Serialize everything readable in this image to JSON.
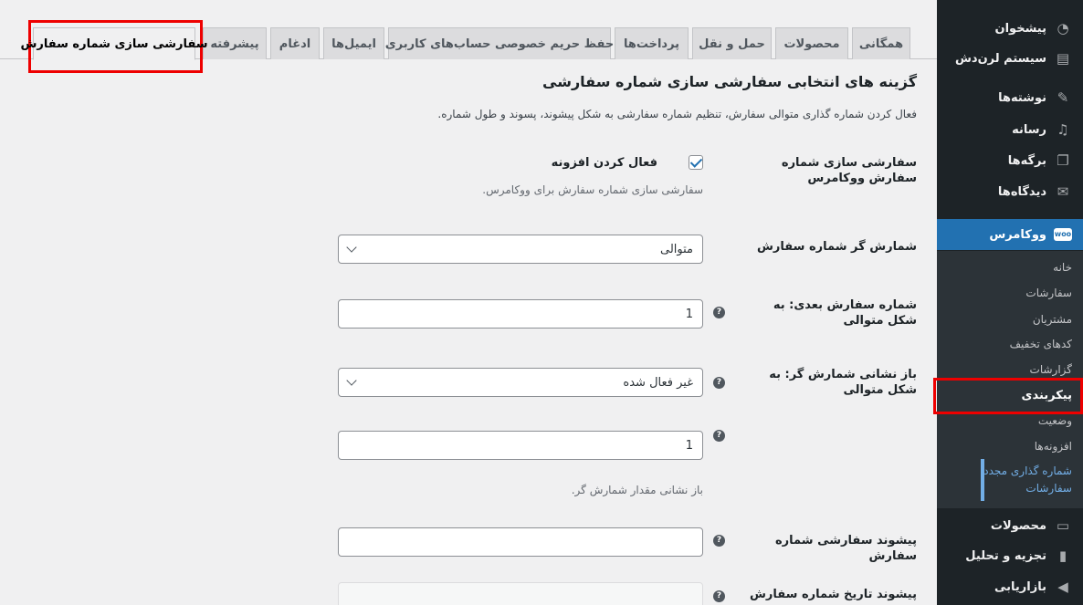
{
  "sidebar": {
    "items": [
      {
        "label": "پیشخوان",
        "icon": "dashboard-icon"
      },
      {
        "label": "سیستم لرن‌دش",
        "icon": "learndash-icon"
      },
      {
        "label": "نوشته‌ها",
        "icon": "pin-icon"
      },
      {
        "label": "رسانه",
        "icon": "media-icon"
      },
      {
        "label": "برگه‌ها",
        "icon": "pages-icon"
      },
      {
        "label": "دیدگاه‌ها",
        "icon": "comments-icon"
      },
      {
        "label": "ووکامرس",
        "icon": "woo-icon"
      },
      {
        "label": "محصولات",
        "icon": "products-icon"
      },
      {
        "label": "تجزیه و تحلیل",
        "icon": "analytics-icon"
      },
      {
        "label": "بازاریابی",
        "icon": "marketing-icon"
      }
    ],
    "woo_badge": "woo",
    "submenu": [
      "خانه",
      "سفارشات",
      "مشتریان",
      "کدهای تخفیف",
      "گزارشات",
      "پیکربندی",
      "وضعیت",
      "افزونه‌ها",
      "شماره گذاری مجدد سفارشات"
    ]
  },
  "tabs": [
    "همگانی",
    "محصولات",
    "حمل و نقل",
    "پرداخت‌ها",
    "حفظ حریم خصوصی حساب‌های کاربری",
    "ایمیل‌ها",
    "ادغام",
    "پیشرفته",
    "سفارشی سازی شماره سفارش"
  ],
  "section": {
    "title": "گزینه های انتخابی سفارشی سازی شماره سفارشی",
    "description": "فعال کردن شماره گذاری متوالی سفارش، تنظیم شماره سفارشی به شکل پیشوند، پسوند و طول شماره."
  },
  "fields": {
    "enable_label": "سفارشی سازی شماره سفارش ووکامرس",
    "enable_checkbox_label": "فعال کردن افزونه",
    "enable_note": "سفارشی سازی شماره سفارش برای ووکامرس.",
    "counter_label": "شمارش گر شماره سفارش",
    "counter_value": "متوالی",
    "next_label": "شماره سفارش بعدی: به شکل متوالی",
    "next_value": "1",
    "reset_label": "باز نشانی شمارش گر: به شکل متوالی",
    "reset_value": "غیر فعال شده",
    "reset_counter_value": "1",
    "reset_note": "باز نشانی مقدار شمارش گر.",
    "prefix_label": "پیشوند سفارشی شماره سفارش",
    "prefix_value": "",
    "date_prefix_label": "پیشوند تاریخ شماره سفارش",
    "help_glyph": "?"
  }
}
